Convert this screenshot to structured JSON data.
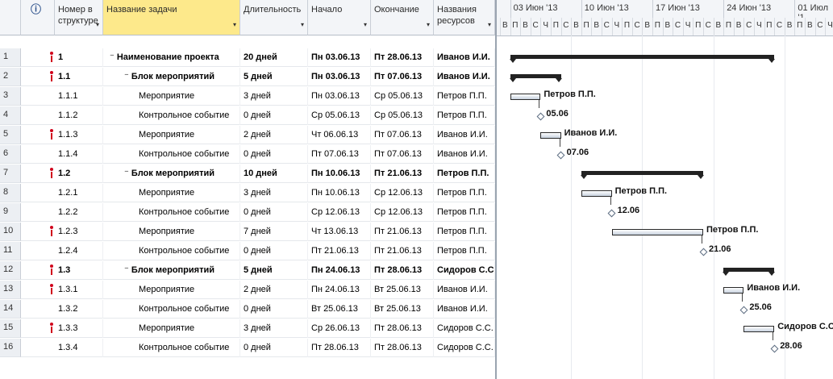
{
  "columns": {
    "info_icon": "ⓘ",
    "wbs": "Номер в структуре",
    "name": "Название задачи",
    "duration": "Длительность",
    "start": "Начало",
    "finish": "Окончание",
    "resources": "Названия ресурсов"
  },
  "timescale": {
    "weeks": [
      "03 Июн '13",
      "10 Июн '13",
      "17 Июн '13",
      "24 Июн '13",
      "01 Июл '1"
    ],
    "days": [
      "В",
      "П",
      "В",
      "С",
      "Ч",
      "П",
      "С",
      "В",
      "П",
      "В",
      "С",
      "Ч",
      "П",
      "С",
      "В",
      "П",
      "В",
      "С",
      "Ч",
      "П",
      "С",
      "В",
      "П",
      "В",
      "С",
      "Ч",
      "П",
      "С",
      "В",
      "П",
      "В",
      "С",
      "Ч"
    ]
  },
  "rows": [
    {
      "id": "1",
      "wbs": "1",
      "name": "Наименование проекта",
      "duration": "20 дней",
      "start": "Пн 03.06.13",
      "finish": "Пт 28.06.13",
      "resources": "Иванов И.И.",
      "bold": true,
      "indicator": true,
      "level": 0,
      "collapse": "⁻"
    },
    {
      "id": "2",
      "wbs": "1.1",
      "name": "Блок мероприятий",
      "duration": "5 дней",
      "start": "Пн 03.06.13",
      "finish": "Пт 07.06.13",
      "resources": "Иванов И.И.",
      "bold": true,
      "indicator": true,
      "level": 1,
      "collapse": "⁻"
    },
    {
      "id": "3",
      "wbs": "1.1.1",
      "name": "Мероприятие",
      "duration": "3 дней",
      "start": "Пн 03.06.13",
      "finish": "Ср 05.06.13",
      "resources": "Петров П.П.",
      "bold": false,
      "indicator": false,
      "level": 2,
      "collapse": ""
    },
    {
      "id": "4",
      "wbs": "1.1.2",
      "name": "Контрольное событие",
      "duration": "0 дней",
      "start": "Ср 05.06.13",
      "finish": "Ср 05.06.13",
      "resources": "Петров П.П.",
      "bold": false,
      "indicator": false,
      "level": 2,
      "collapse": ""
    },
    {
      "id": "5",
      "wbs": "1.1.3",
      "name": "Мероприятие",
      "duration": "2 дней",
      "start": "Чт 06.06.13",
      "finish": "Пт 07.06.13",
      "resources": "Иванов И.И.",
      "bold": false,
      "indicator": true,
      "level": 2,
      "collapse": ""
    },
    {
      "id": "6",
      "wbs": "1.1.4",
      "name": "Контрольное событие",
      "duration": "0 дней",
      "start": "Пт 07.06.13",
      "finish": "Пт 07.06.13",
      "resources": "Иванов И.И.",
      "bold": false,
      "indicator": false,
      "level": 2,
      "collapse": ""
    },
    {
      "id": "7",
      "wbs": "1.2",
      "name": "Блок мероприятий",
      "duration": "10 дней",
      "start": "Пн 10.06.13",
      "finish": "Пт 21.06.13",
      "resources": "Петров П.П.",
      "bold": true,
      "indicator": true,
      "level": 1,
      "collapse": "⁻"
    },
    {
      "id": "8",
      "wbs": "1.2.1",
      "name": "Мероприятие",
      "duration": "3 дней",
      "start": "Пн 10.06.13",
      "finish": "Ср 12.06.13",
      "resources": "Петров П.П.",
      "bold": false,
      "indicator": false,
      "level": 2,
      "collapse": ""
    },
    {
      "id": "9",
      "wbs": "1.2.2",
      "name": "Контрольное событие",
      "duration": "0 дней",
      "start": "Ср 12.06.13",
      "finish": "Ср 12.06.13",
      "resources": "Петров П.П.",
      "bold": false,
      "indicator": false,
      "level": 2,
      "collapse": ""
    },
    {
      "id": "10",
      "wbs": "1.2.3",
      "name": "Мероприятие",
      "duration": "7 дней",
      "start": "Чт 13.06.13",
      "finish": "Пт 21.06.13",
      "resources": "Петров П.П.",
      "bold": false,
      "indicator": true,
      "level": 2,
      "collapse": ""
    },
    {
      "id": "11",
      "wbs": "1.2.4",
      "name": "Контрольное событие",
      "duration": "0 дней",
      "start": "Пт 21.06.13",
      "finish": "Пт 21.06.13",
      "resources": "Петров П.П.",
      "bold": false,
      "indicator": false,
      "level": 2,
      "collapse": ""
    },
    {
      "id": "12",
      "wbs": "1.3",
      "name": "Блок мероприятий",
      "duration": "5 дней",
      "start": "Пн 24.06.13",
      "finish": "Пт 28.06.13",
      "resources": "Сидоров С.С.",
      "bold": true,
      "indicator": true,
      "level": 1,
      "collapse": "⁻"
    },
    {
      "id": "13",
      "wbs": "1.3.1",
      "name": "Мероприятие",
      "duration": "2 дней",
      "start": "Пн 24.06.13",
      "finish": "Вт 25.06.13",
      "resources": "Иванов И.И.",
      "bold": false,
      "indicator": true,
      "level": 2,
      "collapse": ""
    },
    {
      "id": "14",
      "wbs": "1.3.2",
      "name": "Контрольное событие",
      "duration": "0 дней",
      "start": "Вт 25.06.13",
      "finish": "Вт 25.06.13",
      "resources": "Иванов И.И.",
      "bold": false,
      "indicator": false,
      "level": 2,
      "collapse": ""
    },
    {
      "id": "15",
      "wbs": "1.3.3",
      "name": "Мероприятие",
      "duration": "3 дней",
      "start": "Ср 26.06.13",
      "finish": "Пт 28.06.13",
      "resources": "Сидоров С.С.",
      "bold": false,
      "indicator": true,
      "level": 2,
      "collapse": ""
    },
    {
      "id": "16",
      "wbs": "1.3.4",
      "name": "Контрольное событие",
      "duration": "0 дней",
      "start": "Пт 28.06.13",
      "finish": "Пт 28.06.13",
      "resources": "Сидоров С.С.",
      "bold": false,
      "indicator": false,
      "level": 2,
      "collapse": ""
    }
  ],
  "gantt_items": [
    {
      "type": "summary",
      "start": "2013-06-03",
      "finish": "2013-06-28"
    },
    {
      "type": "summary",
      "start": "2013-06-03",
      "finish": "2013-06-07"
    },
    {
      "type": "task",
      "start": "2013-06-03",
      "finish": "2013-06-05",
      "label": "Петров П.П."
    },
    {
      "type": "milestone",
      "start": "2013-06-05",
      "label": "05.06"
    },
    {
      "type": "task",
      "start": "2013-06-06",
      "finish": "2013-06-07",
      "label": "Иванов И.И."
    },
    {
      "type": "milestone",
      "start": "2013-06-07",
      "label": "07.06"
    },
    {
      "type": "summary",
      "start": "2013-06-10",
      "finish": "2013-06-21"
    },
    {
      "type": "task",
      "start": "2013-06-10",
      "finish": "2013-06-12",
      "label": "Петров П.П."
    },
    {
      "type": "milestone",
      "start": "2013-06-12",
      "label": "12.06"
    },
    {
      "type": "task",
      "start": "2013-06-13",
      "finish": "2013-06-21",
      "label": "Петров П.П."
    },
    {
      "type": "milestone",
      "start": "2013-06-21",
      "label": "21.06"
    },
    {
      "type": "summary",
      "start": "2013-06-24",
      "finish": "2013-06-28"
    },
    {
      "type": "task",
      "start": "2013-06-24",
      "finish": "2013-06-25",
      "label": "Иванов И.И."
    },
    {
      "type": "milestone",
      "start": "2013-06-25",
      "label": "25.06"
    },
    {
      "type": "task",
      "start": "2013-06-26",
      "finish": "2013-06-28",
      "label": "Сидоров С.С."
    },
    {
      "type": "milestone",
      "start": "2013-06-28",
      "label": "28.06"
    }
  ]
}
